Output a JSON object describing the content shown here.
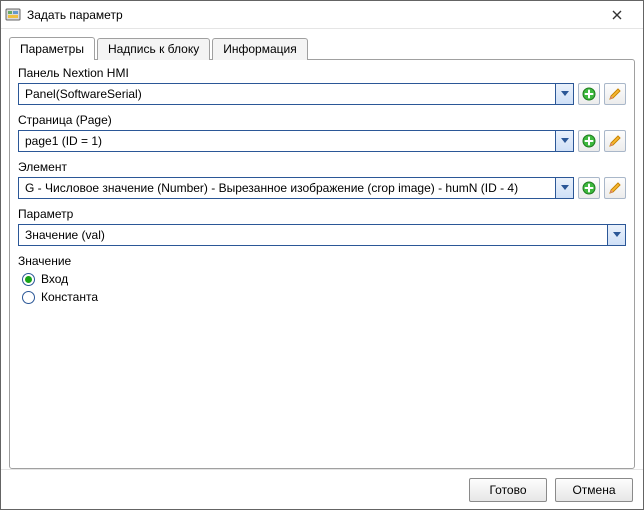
{
  "window": {
    "title": "Задать параметр"
  },
  "tabs": [
    {
      "label": "Параметры",
      "active": true
    },
    {
      "label": "Надпись к блоку",
      "active": false
    },
    {
      "label": "Информация",
      "active": false
    }
  ],
  "fields": {
    "panel": {
      "label": "Панель Nextion HMI",
      "value": "Panel(SoftwareSerial)"
    },
    "page": {
      "label": "Страница (Page)",
      "value": "page1 (ID = 1)"
    },
    "element": {
      "label": "Элемент",
      "value": "G - Числовое значение (Number) - Вырезанное изображение (crop image) - humN (ID - 4)"
    },
    "param": {
      "label": "Параметр",
      "value": "Значение (val)"
    },
    "value": {
      "label": "Значение",
      "options": [
        {
          "label": "Вход",
          "checked": true
        },
        {
          "label": "Константа",
          "checked": false
        }
      ]
    }
  },
  "footer": {
    "ok": "Готово",
    "cancel": "Отмена"
  }
}
